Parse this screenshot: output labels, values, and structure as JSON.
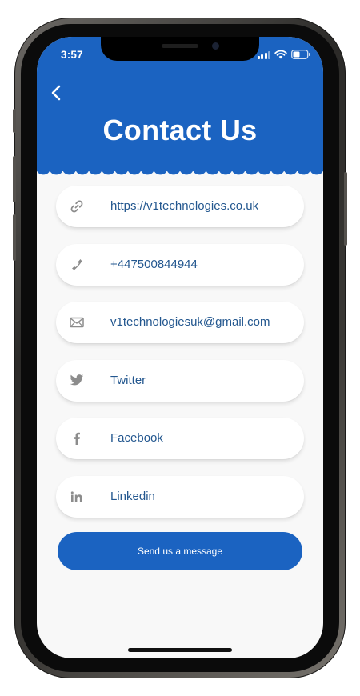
{
  "status_bar": {
    "time": "3:57"
  },
  "header": {
    "back_icon": "chevron-left-icon",
    "title": "Contact Us"
  },
  "contacts": [
    {
      "icon": "link-icon",
      "label": "https://v1technologies.co.uk"
    },
    {
      "icon": "phone-icon",
      "label": "+447500844944"
    },
    {
      "icon": "envelope-icon",
      "label": "v1technologiesuk@gmail.com"
    },
    {
      "icon": "twitter-icon",
      "label": "Twitter"
    },
    {
      "icon": "facebook-icon",
      "label": "Facebook"
    },
    {
      "icon": "linkedin-icon",
      "label": "Linkedin"
    }
  ],
  "send_button": {
    "label": "Send us a message"
  },
  "colors": {
    "brand": "#1b63c1",
    "link_text": "#23578f",
    "icon": "#8c8c8c",
    "background": "#f8f8f8"
  }
}
